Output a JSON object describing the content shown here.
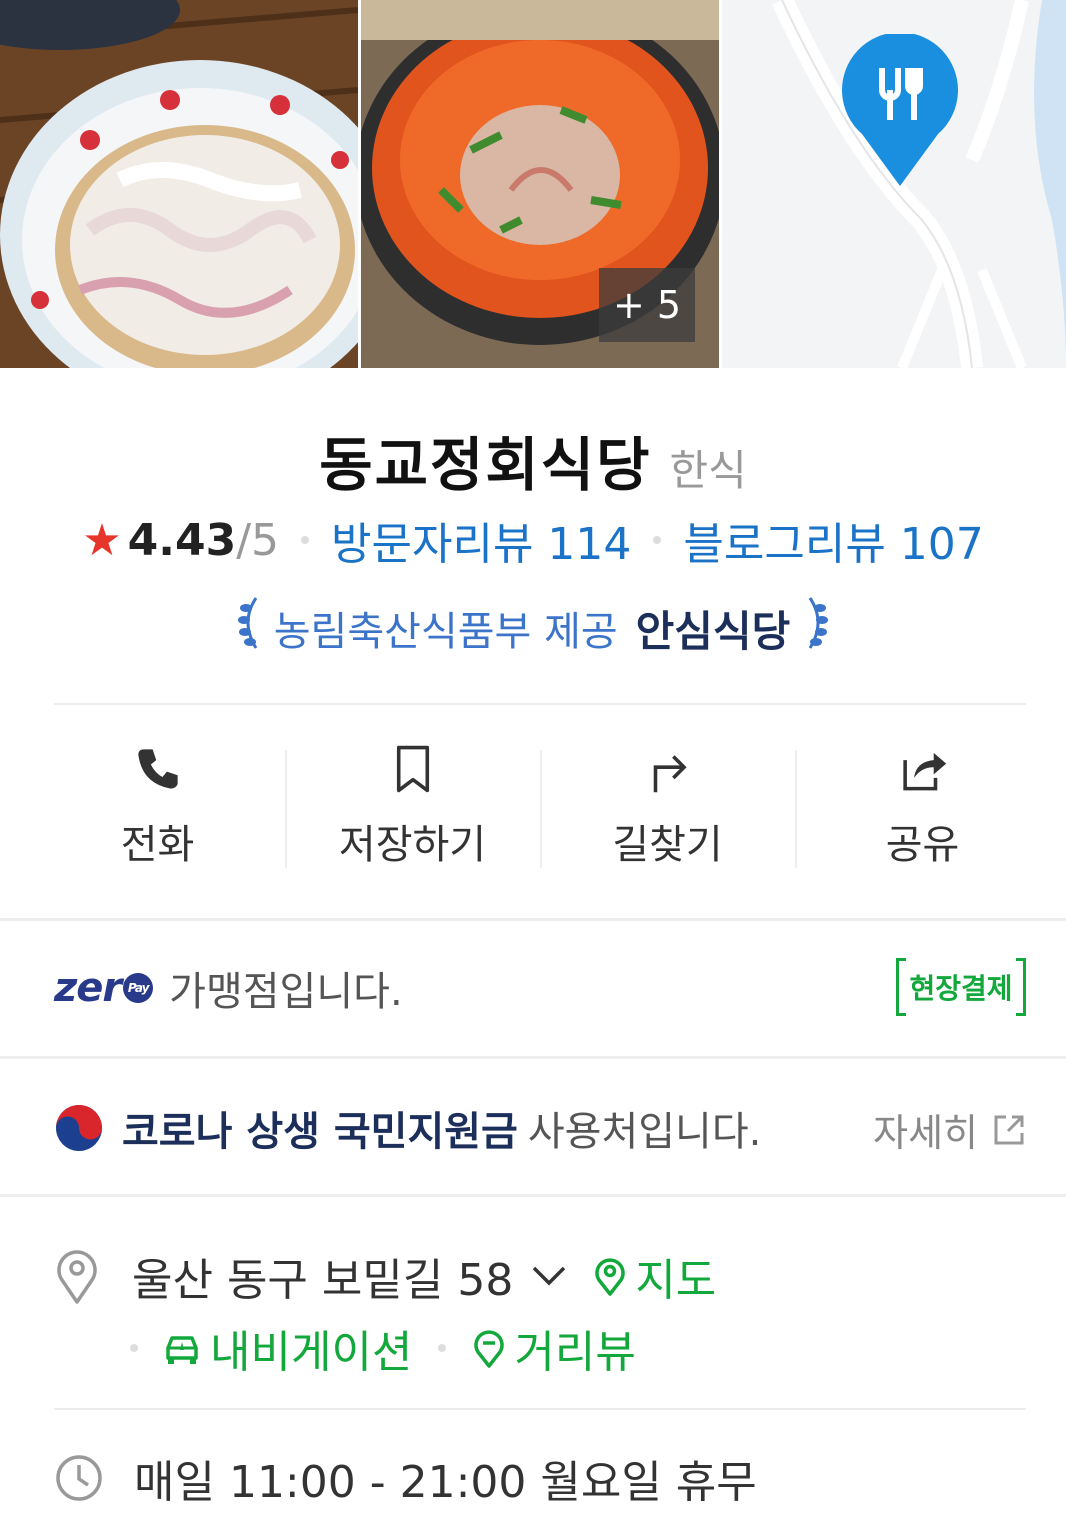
{
  "photos": {
    "more_count": "+ 5"
  },
  "place": {
    "name": "동교정회식당",
    "category": "한식",
    "rating_score": "4.43",
    "rating_max": "/5",
    "visitor_review": "방문자리뷰 114",
    "blog_review": "블로그리뷰 107",
    "safe_provider": "농림축산식품부 제공",
    "safe_badge": "안심식당"
  },
  "actions": [
    {
      "label": "전화",
      "icon": "phone-icon"
    },
    {
      "label": "저장하기",
      "icon": "bookmark-icon"
    },
    {
      "label": "길찾기",
      "icon": "directions-icon"
    },
    {
      "label": "공유",
      "icon": "share-icon"
    }
  ],
  "zeropay": {
    "logo": "zer",
    "logo_badge": "Pay",
    "text": "가맹점입니다.",
    "badge": "현장결제"
  },
  "corona": {
    "bold": "코로나 상생 국민지원금",
    "text": "사용처입니다.",
    "detail": "자세히"
  },
  "address": {
    "text": "울산 동구 보밑길 58",
    "map": "지도",
    "navigation": "내비게이션",
    "streetview": "거리뷰"
  },
  "hours": {
    "text": "매일 11:00 - 21:00 월요일 휴무"
  },
  "colors": {
    "blue_link": "#1a73c7",
    "green": "#13a83b",
    "star": "#e6352b",
    "map_pin": "#1a8fe0",
    "navy": "#1c2e5a"
  }
}
